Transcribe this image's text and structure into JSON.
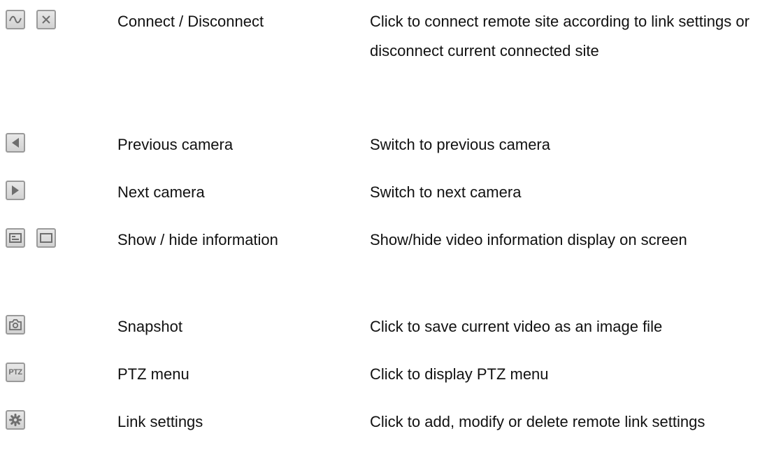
{
  "rows": [
    {
      "name": "Connect / Disconnect",
      "description": "Click to connect remote site according to link settings or disconnect current connected site",
      "icons": [
        "connect-wave-icon",
        "disconnect-x-icon"
      ]
    },
    {
      "name": "Previous camera",
      "description": "Switch to previous camera",
      "icons": [
        "previous-camera-icon"
      ]
    },
    {
      "name": "Next camera",
      "description": "Switch to next camera",
      "icons": [
        "next-camera-icon"
      ]
    },
    {
      "name": "Show / hide information",
      "description": "Show/hide video information display on screen",
      "icons": [
        "show-information-icon",
        "hide-information-icon"
      ]
    },
    {
      "name": "Snapshot",
      "description": "Click to save current video as an image file",
      "icons": [
        "snapshot-camera-icon"
      ]
    },
    {
      "name": "PTZ menu",
      "description": "Click to display PTZ menu",
      "icons": [
        "ptz-menu-icon"
      ],
      "icon_text": "PTZ"
    },
    {
      "name": "Link settings",
      "description": "Click to add, modify or delete remote link settings",
      "icons": [
        "link-settings-gear-icon"
      ]
    }
  ],
  "colors": {
    "icon_border": "#9a9a9a",
    "icon_fill": "#dcdcdc",
    "icon_glyph": "#6e6e6e",
    "text": "#111111"
  }
}
